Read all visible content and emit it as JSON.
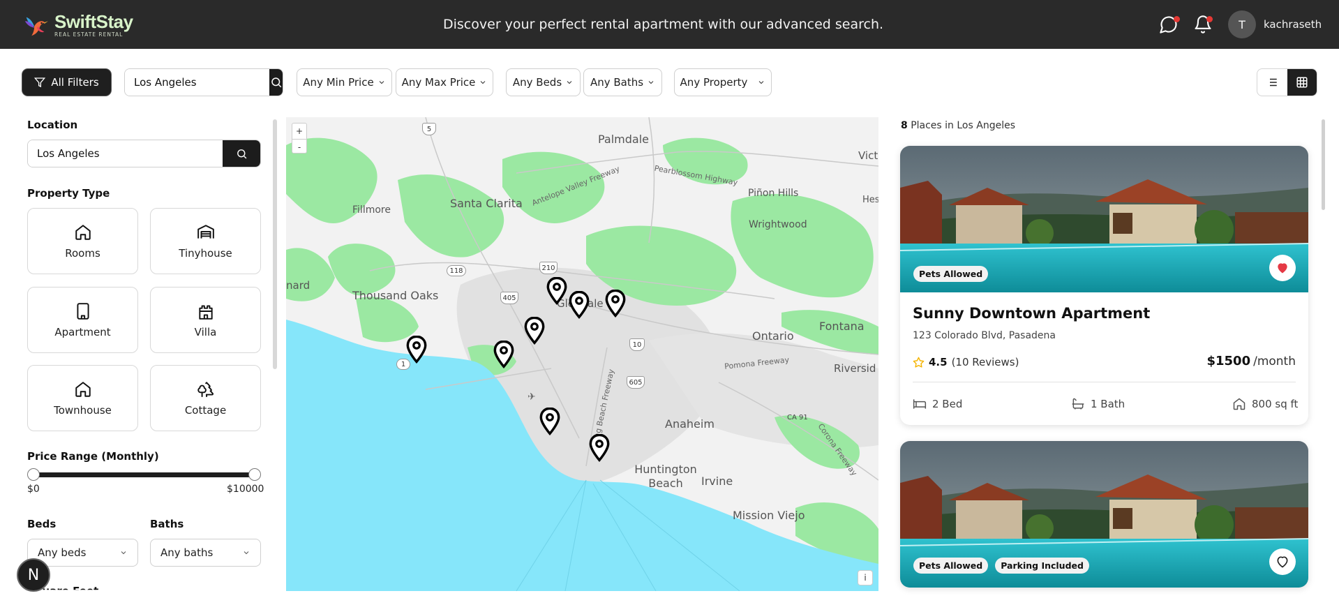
{
  "navbar": {
    "brand_name": "SwiftStay",
    "brand_tagline": "REAL ESTATE RENTAL",
    "tagline": "Discover your perfect rental apartment with our advanced search.",
    "avatar_initial": "T",
    "username": "kachraseth",
    "icons": [
      "chat-icon",
      "bell-icon"
    ]
  },
  "filter_bar": {
    "all_filters_label": "All Filters",
    "search_value": "Los Angeles",
    "min_price_label": "Any Min Price",
    "max_price_label": "Any Max Price",
    "beds_label": "Any Beds",
    "baths_label": "Any Baths",
    "property_label": "Any Property",
    "active_view": "grid"
  },
  "sidebar": {
    "location_label": "Location",
    "location_value": "Los Angeles",
    "property_type_label": "Property Type",
    "property_types": [
      {
        "label": "Rooms",
        "icon": "house-icon"
      },
      {
        "label": "Tinyhouse",
        "icon": "warehouse-icon"
      },
      {
        "label": "Apartment",
        "icon": "building-icon"
      },
      {
        "label": "Villa",
        "icon": "castle-icon"
      },
      {
        "label": "Townhouse",
        "icon": "house-icon"
      },
      {
        "label": "Cottage",
        "icon": "trees-icon"
      }
    ],
    "price_range_label": "Price Range (Monthly)",
    "price_min": "$0",
    "price_max": "$10000",
    "beds_label": "Beds",
    "baths_label": "Baths",
    "beds_value": "Any beds",
    "baths_value": "Any baths",
    "square_feet_label": "Square Feet",
    "badge_letter": "N"
  },
  "map": {
    "zoom_in": "+",
    "zoom_out": "-",
    "info": "i",
    "places": [
      {
        "label": "Palmdale"
      },
      {
        "label": "Santa Clarita"
      },
      {
        "label": "Fillmore"
      },
      {
        "label": "Piñon Hills"
      },
      {
        "label": "Wrightwood"
      },
      {
        "label": "Thousand Oaks"
      },
      {
        "label": "Glendale"
      },
      {
        "label": "Ontario"
      },
      {
        "label": "Fontana"
      },
      {
        "label": "Riversid"
      },
      {
        "label": "Anaheim"
      },
      {
        "label": "Huntington Beach"
      },
      {
        "label": "Irvine"
      },
      {
        "label": "Mission Viejo"
      },
      {
        "label": "Vict"
      },
      {
        "label": "Hes"
      },
      {
        "label": "nard"
      }
    ],
    "roads": [
      {
        "label": "Antelope Valley Freeway"
      },
      {
        "label": "Pearblossom Highway"
      },
      {
        "label": "Pomona Freeway"
      },
      {
        "label": "Long Beach Freeway"
      },
      {
        "label": "Corona Freeway"
      }
    ],
    "shields": [
      {
        "label": "5"
      },
      {
        "label": "118"
      },
      {
        "label": "210"
      },
      {
        "label": "405"
      },
      {
        "label": "10"
      },
      {
        "label": "605"
      },
      {
        "label": "1"
      },
      {
        "label": "CA 91"
      }
    ]
  },
  "listings": {
    "count": "8",
    "count_suffix": "Places in Los Angeles",
    "cards": [
      {
        "title": "Sunny Downtown Apartment",
        "address": "123 Colorado Blvd, Pasadena",
        "rating": "4.5",
        "reviews": "(10 Reviews)",
        "price": "$1500",
        "price_unit": "/month",
        "beds": "2 Bed",
        "baths": "1 Bath",
        "area": "800 sq ft",
        "tags": [
          "Pets Allowed"
        ],
        "favorited": true
      },
      {
        "title": "",
        "tags": [
          "Pets Allowed",
          "Parking Included"
        ],
        "favorited": false
      }
    ]
  },
  "colors": {
    "navbar_bg": "#2a2a2a",
    "accent_dark": "#1c1c1c",
    "heart_red": "#e53945",
    "star_yellow": "#f5b400",
    "map_water": "#86e6fa",
    "map_green": "#9be8a2"
  }
}
